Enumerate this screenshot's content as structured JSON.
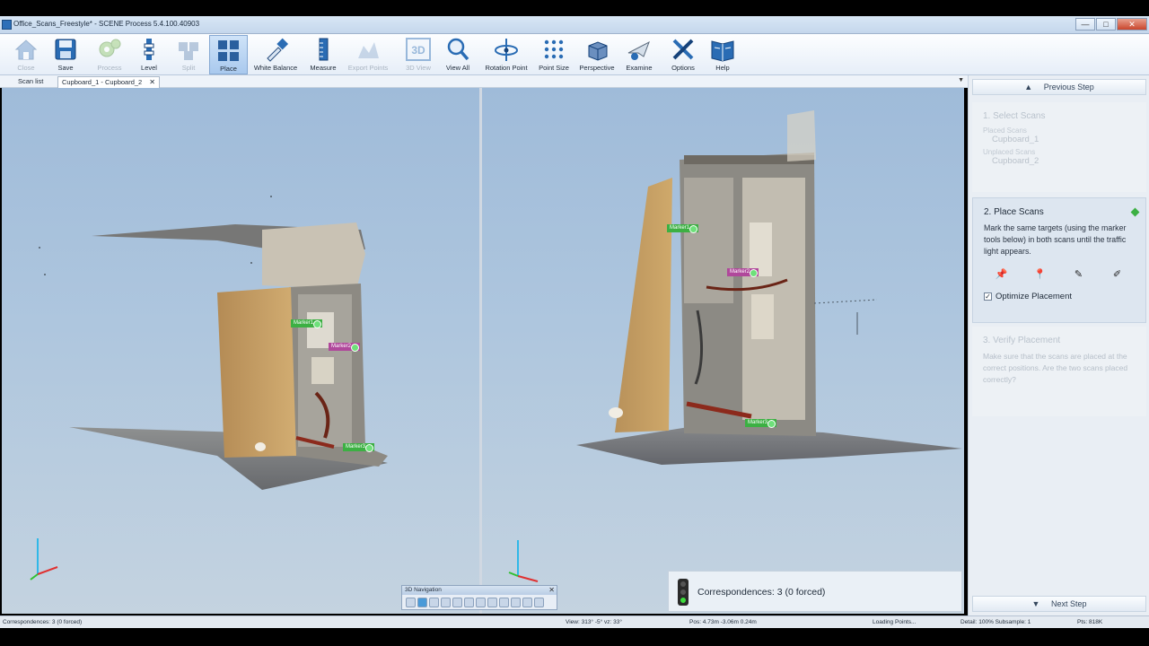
{
  "window": {
    "title": "Office_Scans_Freestyle* - SCENE Process 5.4.100.40903",
    "min": "—",
    "max": "□",
    "close": "✕"
  },
  "toolbar": {
    "items": [
      {
        "id": "close",
        "label": "Close",
        "enabled": false
      },
      {
        "id": "save",
        "label": "Save",
        "enabled": true
      },
      {
        "id": "process",
        "label": "Process",
        "enabled": false
      },
      {
        "id": "level",
        "label": "Level",
        "enabled": true
      },
      {
        "id": "split",
        "label": "Split",
        "enabled": false
      },
      {
        "id": "place",
        "label": "Place",
        "enabled": true,
        "active": true
      },
      {
        "id": "white-balance",
        "label": "White Balance",
        "enabled": true
      },
      {
        "id": "measure",
        "label": "Measure",
        "enabled": true
      },
      {
        "id": "export-points",
        "label": "Export Points",
        "enabled": false
      },
      {
        "id": "3d-view",
        "label": "3D View",
        "enabled": false
      },
      {
        "id": "view-all",
        "label": "View All",
        "enabled": true
      },
      {
        "id": "rotation-point",
        "label": "Rotation Point",
        "enabled": true
      },
      {
        "id": "point-size",
        "label": "Point Size",
        "enabled": true
      },
      {
        "id": "perspective",
        "label": "Perspective",
        "enabled": true
      },
      {
        "id": "examine",
        "label": "Examine",
        "enabled": true
      },
      {
        "id": "options",
        "label": "Options",
        "enabled": true
      },
      {
        "id": "help",
        "label": "Help",
        "enabled": true
      }
    ]
  },
  "tabs": [
    {
      "label": "Scan list",
      "active": false
    },
    {
      "label": "Cupboard_1 - Cupboard_2",
      "active": true,
      "close": "✕"
    }
  ],
  "tab_menu": "▼",
  "markers": {
    "left": [
      "Marker1",
      "Marker2",
      "Marker3"
    ],
    "right": [
      "Marker1",
      "Marker2",
      "Marker3"
    ]
  },
  "nav3d": {
    "title": "3D Navigation",
    "close": "✕"
  },
  "correspondences": "Correspondences: 3 (0 forced)",
  "panel": {
    "prev_step": "Previous Step",
    "next_step": "Next Step",
    "step1": {
      "title": "1. Select Scans",
      "placed_label": "Placed Scans",
      "placed_scan": "Cupboard_1",
      "unplaced_label": "Unplaced Scans",
      "unplaced_scan": "Cupboard_2"
    },
    "step2": {
      "title": "2. Place Scans",
      "description": "Mark the same targets (using the marker tools below) in both scans until the traffic light appears.",
      "option": "Optimize Placement",
      "option_checked": true
    },
    "step3": {
      "title": "3. Verify Placement",
      "description": "Make sure that the scans are placed at the correct positions. Are the two scans placed correctly?"
    }
  },
  "statusbar": {
    "left": "Correspondences: 3 (0 forced)",
    "view": "View: 313° -5° vz: 33°",
    "pos": "Pos: 4.73m -3.06m 0.24m",
    "loading": "Loading Points...",
    "detail": "Detail: 100%  Subsample: 1",
    "pts": "Pts: 818K"
  }
}
